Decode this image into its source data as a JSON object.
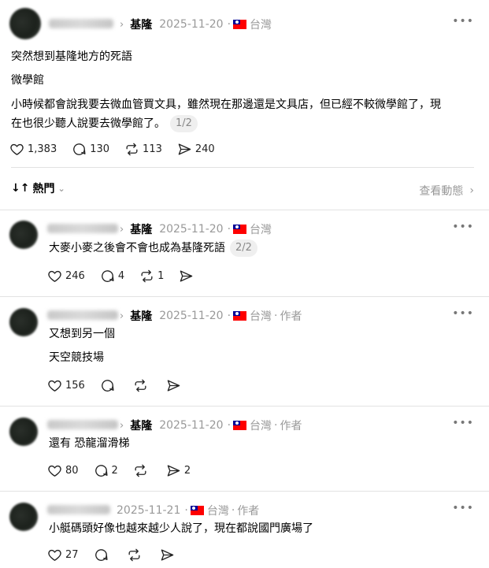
{
  "main_post": {
    "topic": "基隆",
    "date": "2025-11-20",
    "location": "台灣",
    "lines": [
      "突然想到基隆地方的死語",
      "微學館",
      "小時候都會說我要去微血管買文具，雖然現在那邊還是文具店，但已經不較微學館了，現",
      "在也很少聽人說要去微學館了。"
    ],
    "pager": "1/2",
    "likes": "1,383",
    "comments": "130",
    "reposts": "113",
    "shares": "240"
  },
  "sort": {
    "label": "熱門",
    "activity": "查看動態"
  },
  "replies": [
    {
      "topic": "基隆",
      "date": "2025-11-20",
      "location": "台灣",
      "author_tag": "",
      "lines": [
        "大麥小麥之後會不會也成為基隆死語"
      ],
      "pager": "2/2",
      "likes": "246",
      "comments": "4",
      "reposts": "1",
      "shares": ""
    },
    {
      "topic": "基隆",
      "date": "2025-11-20",
      "location": "台灣",
      "author_tag": "作者",
      "lines": [
        "又想到另一個",
        "天空競技場"
      ],
      "pager": "",
      "likes": "156",
      "comments": "",
      "reposts": "",
      "shares": ""
    },
    {
      "topic": "基隆",
      "date": "2025-11-20",
      "location": "台灣",
      "author_tag": "作者",
      "lines": [
        "還有 恐龍溜滑梯"
      ],
      "pager": "",
      "likes": "80",
      "comments": "2",
      "reposts": "",
      "shares": "2"
    },
    {
      "topic": "",
      "date": "2025-11-21",
      "location": "台灣",
      "author_tag": "作者",
      "lines": [
        "小艇碼頭好像也越來越少人說了，現在都說國門廣場了"
      ],
      "pager": "",
      "likes": "27",
      "comments": "",
      "reposts": "",
      "shares": ""
    }
  ],
  "icons": {
    "like": "heart-icon",
    "comment": "speech-bubble-icon",
    "repost": "repost-icon",
    "share": "send-icon",
    "more": "more-dots-icon",
    "flag": "taiwan-flag-icon"
  }
}
